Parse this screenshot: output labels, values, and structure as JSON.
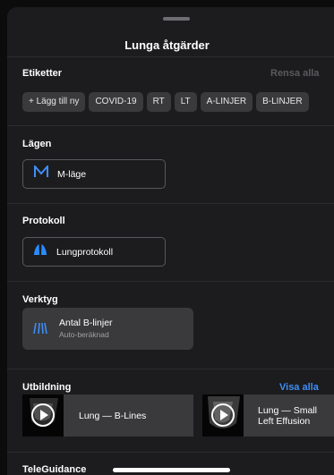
{
  "sheet": {
    "title": "Lunga åtgärder"
  },
  "tags": {
    "title": "Etiketter",
    "clear_label": "Rensa alla",
    "items": [
      "+ Lägg till ny",
      "COVID-19",
      "RT",
      "LT",
      "A-LINJER",
      "B-LINJER"
    ]
  },
  "modes": {
    "title": "Lägen",
    "button_label": "M-läge"
  },
  "protocol": {
    "title": "Protokoll",
    "button_label": "Lungprotokoll"
  },
  "tools": {
    "title": "Verktyg",
    "card_title": "Antal B-linjer",
    "card_subtitle": "Auto-beräknad"
  },
  "education": {
    "title": "Utbildning",
    "see_all": "Visa alla",
    "items": [
      "Lung — B-Lines",
      "Lung — Small\nLeft Effusion"
    ]
  },
  "next_section": {
    "title": "TeleGuidance"
  },
  "colors": {
    "accent": "#3d8ef7",
    "protocol_icon": "#2a8cff",
    "mode_icon": "#3d8ef7",
    "disabled": "#5a5a5e"
  },
  "icons": {
    "mode": "m-mode-icon",
    "protocol": "lung-icon",
    "tool": "b-lines-icon",
    "video": "play-icon"
  }
}
